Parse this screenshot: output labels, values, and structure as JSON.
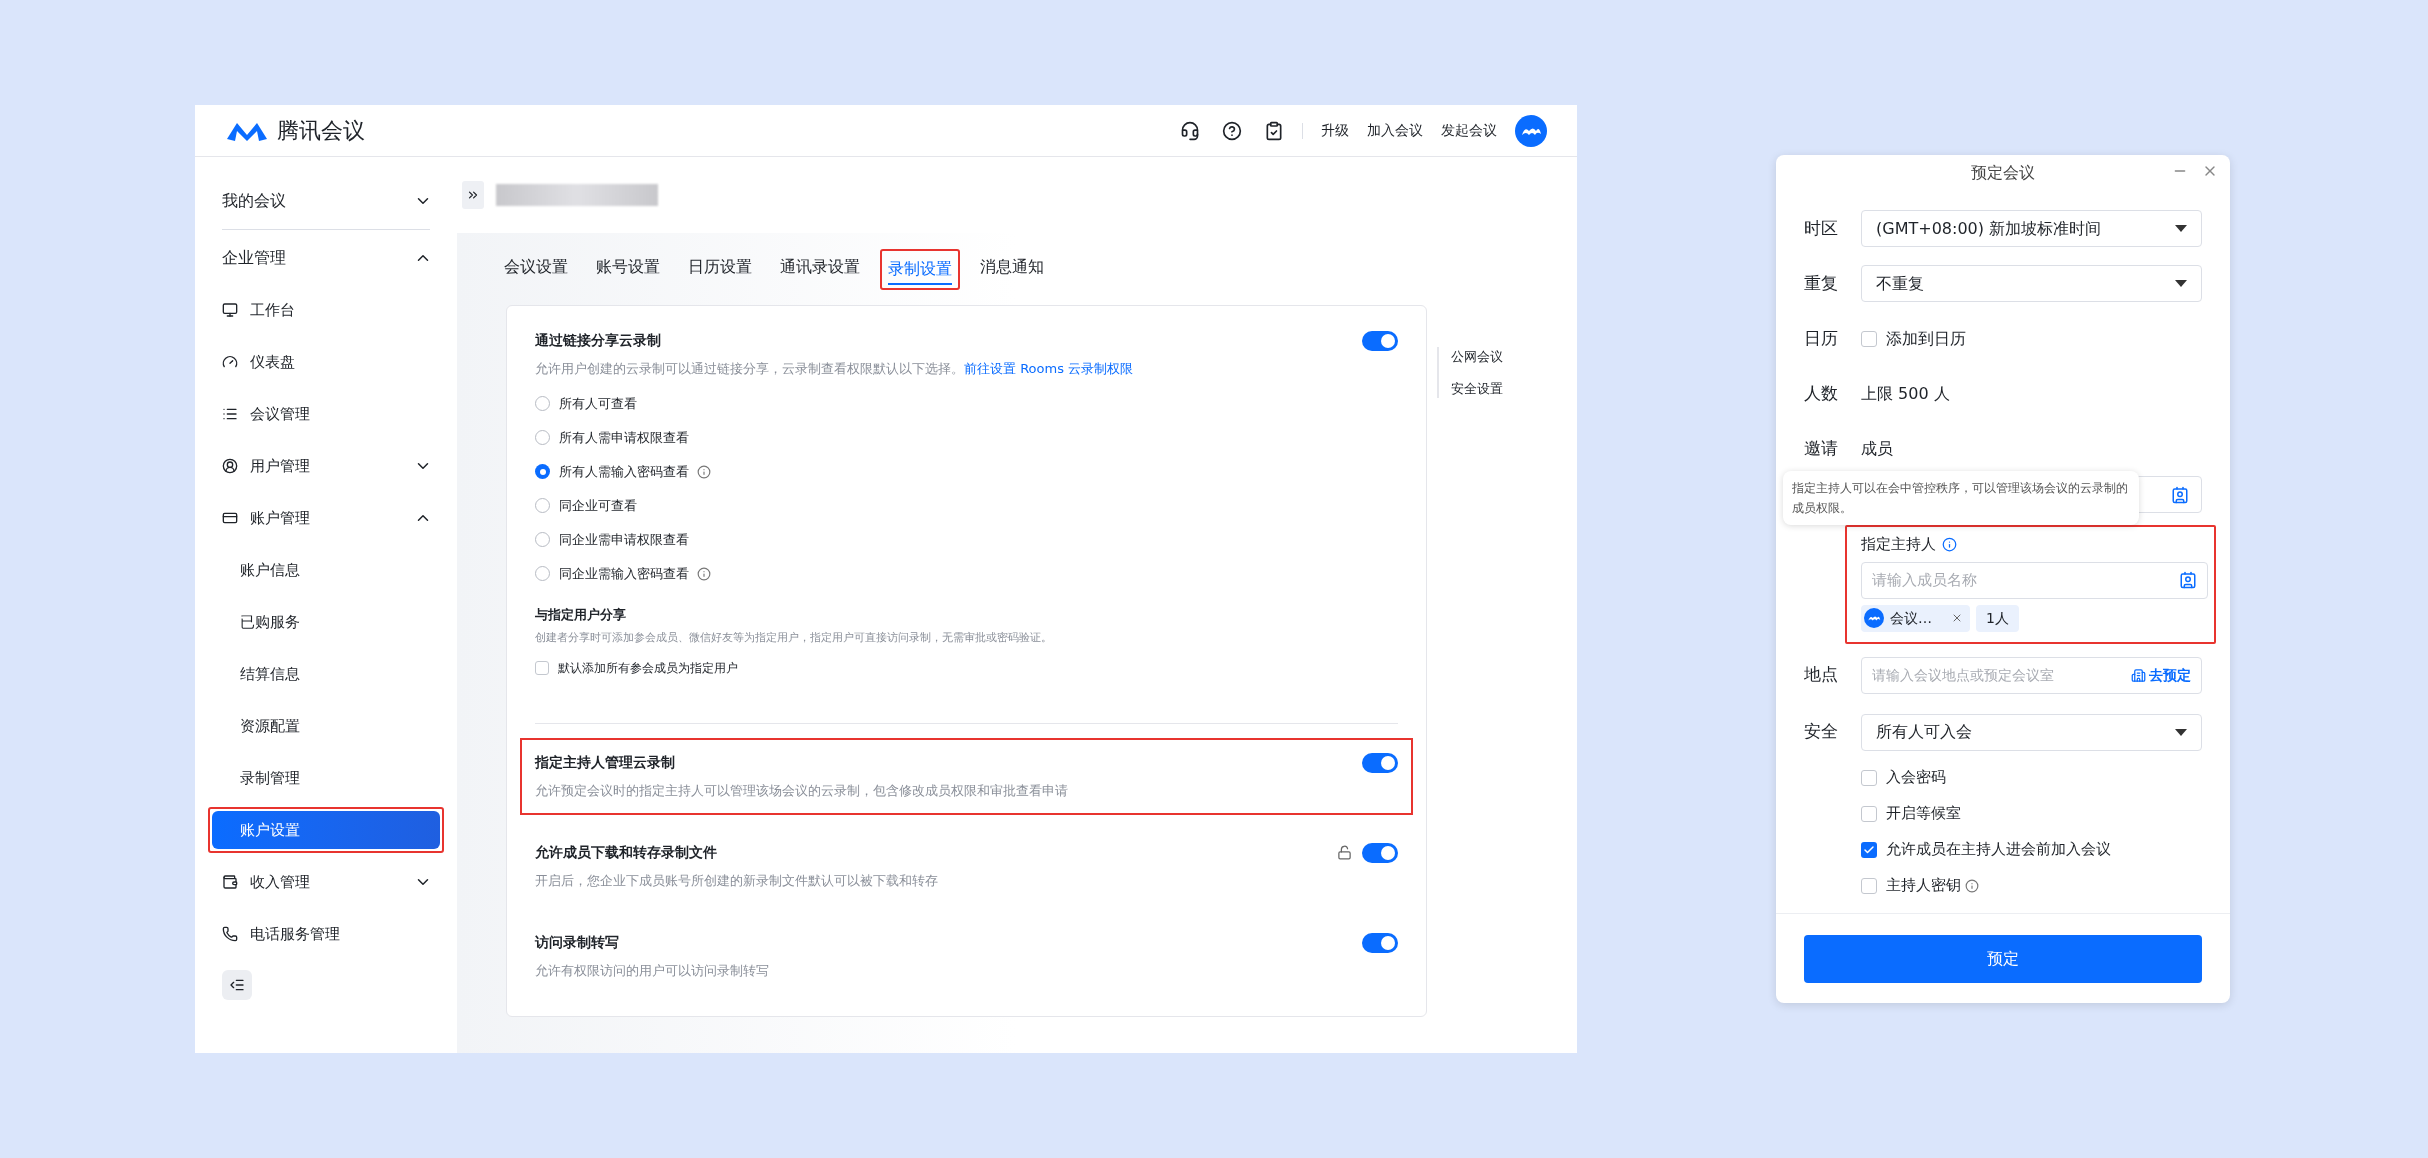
{
  "header": {
    "logo_text": "腾讯会议",
    "links": [
      "升级",
      "加入会议",
      "发起会议"
    ]
  },
  "sidebar": {
    "items": [
      {
        "label": "我的会议",
        "kind": "section",
        "expanded": false,
        "selected": false,
        "highlighted": false
      },
      {
        "label": "企业管理",
        "kind": "section",
        "expanded": true,
        "selected": false,
        "highlighted": false
      },
      {
        "label": "工作台",
        "kind": "item",
        "selected": false,
        "highlighted": false
      },
      {
        "label": "仪表盘",
        "kind": "item",
        "selected": false,
        "highlighted": false
      },
      {
        "label": "会议管理",
        "kind": "item",
        "selected": false,
        "highlighted": false
      },
      {
        "label": "用户管理",
        "kind": "item",
        "expanded": false,
        "selected": false,
        "highlighted": false
      },
      {
        "label": "账户管理",
        "kind": "item",
        "expanded": true,
        "selected": false,
        "highlighted": false
      },
      {
        "label": "账户信息",
        "kind": "sub",
        "selected": false,
        "highlighted": false
      },
      {
        "label": "已购服务",
        "kind": "sub",
        "selected": false,
        "highlighted": false
      },
      {
        "label": "结算信息",
        "kind": "sub",
        "selected": false,
        "highlighted": false
      },
      {
        "label": "资源配置",
        "kind": "sub",
        "selected": false,
        "highlighted": false
      },
      {
        "label": "录制管理",
        "kind": "sub",
        "selected": false,
        "highlighted": false
      },
      {
        "label": "账户设置",
        "kind": "sub",
        "selected": true,
        "highlighted": true
      },
      {
        "label": "收入管理",
        "kind": "item",
        "expanded": false,
        "selected": false,
        "highlighted": false
      },
      {
        "label": "电话服务管理",
        "kind": "item",
        "selected": false,
        "highlighted": false
      }
    ]
  },
  "tabs": [
    {
      "label": "会议设置",
      "selected": false,
      "highlighted": false
    },
    {
      "label": "账号设置",
      "selected": false,
      "highlighted": false
    },
    {
      "label": "日历设置",
      "selected": false,
      "highlighted": false
    },
    {
      "label": "通讯录设置",
      "selected": false,
      "highlighted": false
    },
    {
      "label": "录制设置",
      "selected": true,
      "highlighted": true
    },
    {
      "label": "消息通知",
      "selected": false,
      "highlighted": false
    }
  ],
  "share_link": {
    "title": "通过链接分享云录制",
    "on": true,
    "description": "允许用户创建的云录制可以通过链接分享，云录制查看权限默认以下选择。",
    "link": "前往设置 Rooms 云录制权限",
    "options": [
      {
        "label": "所有人可查看",
        "selected": false,
        "info": false
      },
      {
        "label": "所有人需申请权限查看",
        "selected": false,
        "info": false
      },
      {
        "label": "所有人需输入密码查看",
        "selected": true,
        "info": true
      },
      {
        "label": "同企业可查看",
        "selected": false,
        "info": false
      },
      {
        "label": "同企业需申请权限查看",
        "selected": false,
        "info": false
      },
      {
        "label": "同企业需输入密码查看",
        "selected": false,
        "info": true
      }
    ]
  },
  "share_users": {
    "title": "与指定用户分享",
    "description": "创建者分享时可添加参会成员、微信好友等为指定用户，指定用户可直接访问录制，无需审批或密码验证。",
    "checkbox": {
      "label": "默认添加所有参会成员为指定用户",
      "checked": false
    }
  },
  "toggles": [
    {
      "title": "指定主持人管理云录制",
      "description": "允许预定会议时的指定主持人可以管理该场会议的云录制，包含修改成员权限和审批查看申请",
      "on": true,
      "locked": false,
      "highlighted": true
    },
    {
      "title": "允许成员下载和转存录制文件",
      "description": "开启后，您企业下成员账号所创建的新录制文件默认可以被下载和转存",
      "on": true,
      "locked": true,
      "highlighted": false
    },
    {
      "title": "访问录制转写",
      "description": "允许有权限访问的用户可以访问录制转写",
      "on": true,
      "locked": false,
      "highlighted": false
    }
  ],
  "anchor_nav": [
    "公网会议",
    "安全设置"
  ],
  "dialog": {
    "title": "预定会议",
    "rows": [
      {
        "kind": "select",
        "label": "时区",
        "value": "(GMT+08:00) 新加坡标准时间"
      },
      {
        "kind": "select",
        "label": "重复",
        "value": "不重复"
      },
      {
        "kind": "checkbox",
        "label": "日历",
        "text": "添加到日历",
        "checked": false
      },
      {
        "kind": "text",
        "label": "人数",
        "value": "上限 500 人"
      },
      {
        "kind": "text",
        "label": "邀请",
        "value": "成员"
      }
    ],
    "tooltip": "指定主持人可以在会中管控秩序，可以管理该场会议的云录制的成员权限。",
    "host": {
      "title": "指定主持人",
      "placeholder": "请输入成员名称",
      "chip": "会议…",
      "count": "1人",
      "highlighted": true
    },
    "location": {
      "label": "地点",
      "placeholder": "请输入会议地点或预定会议室",
      "action": "去预定"
    },
    "security": {
      "label": "安全",
      "value": "所有人可入会",
      "options": [
        {
          "label": "入会密码",
          "checked": false,
          "info": false
        },
        {
          "label": "开启等候室",
          "checked": false,
          "info": false
        },
        {
          "label": "允许成员在主持人进会前加入会议",
          "checked": true,
          "info": false
        },
        {
          "label": "主持人密钥",
          "checked": false,
          "info": true
        }
      ]
    },
    "submit": "预定"
  }
}
